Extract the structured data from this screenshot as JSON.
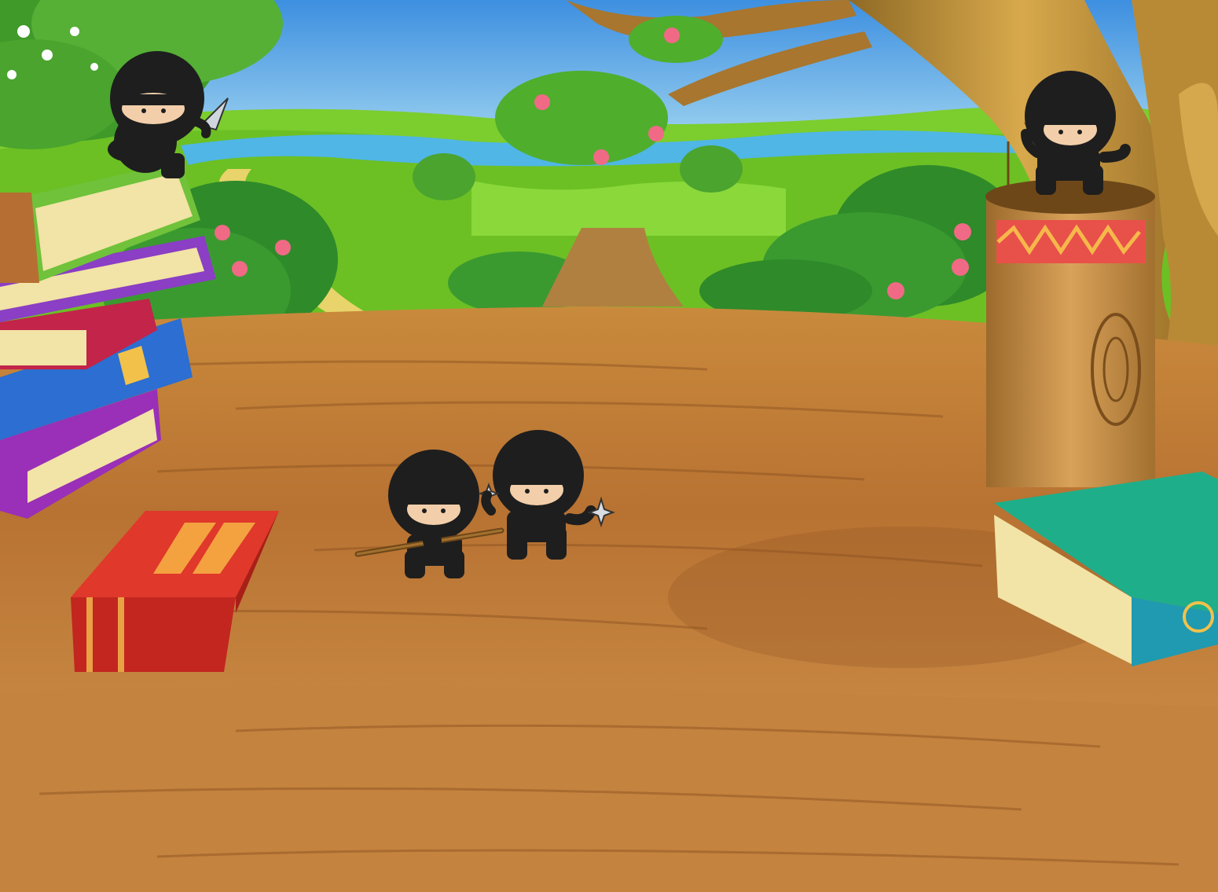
{
  "scene": {
    "name": "forest-table-ninja-scene",
    "colors": {
      "sky_top": "#3d8fe0",
      "sky_bottom": "#b6e4f4",
      "river": "#4fb6e6",
      "meadow": "#7ccd2e",
      "meadow_dark": "#4f9f1e",
      "bush": "#2f8a2a",
      "flower": "#f06a86",
      "table_light": "#d79a4c",
      "table_mid": "#b97530",
      "table_dark": "#8a5020",
      "trunk": "#c08a3a",
      "ninja_body": "#1e1e1e",
      "ninja_skin": "#f2cfaa"
    }
  },
  "books": [
    {
      "id": "book-green-top",
      "cover": "#6fc23a",
      "pages": "#f2e3a6"
    },
    {
      "id": "book-purple-upper",
      "cover": "#8a3fc4",
      "pages": "#f2e3a6"
    },
    {
      "id": "book-red-middle",
      "cover": "#c2244a",
      "pages": "#f2e3a6"
    },
    {
      "id": "book-blue",
      "cover": "#2c6ed1",
      "pages": "#f2e3a6"
    },
    {
      "id": "book-purple-bottom",
      "cover": "#9a2fb8",
      "pages": "#f2e3a6"
    },
    {
      "id": "book-red-floor",
      "cover": "#e0382a",
      "pages": "#f2e3a6"
    },
    {
      "id": "book-teal",
      "cover": "#1fae8a",
      "pages": "#f2e3a6"
    }
  ],
  "ninjas": [
    {
      "id": "ninja-top-left",
      "weapon": "kunai"
    },
    {
      "id": "ninja-center-left",
      "weapon": "bo-staff"
    },
    {
      "id": "ninja-center-right",
      "weapon": "shuriken"
    },
    {
      "id": "ninja-stump",
      "weapon": "sticks"
    }
  ]
}
